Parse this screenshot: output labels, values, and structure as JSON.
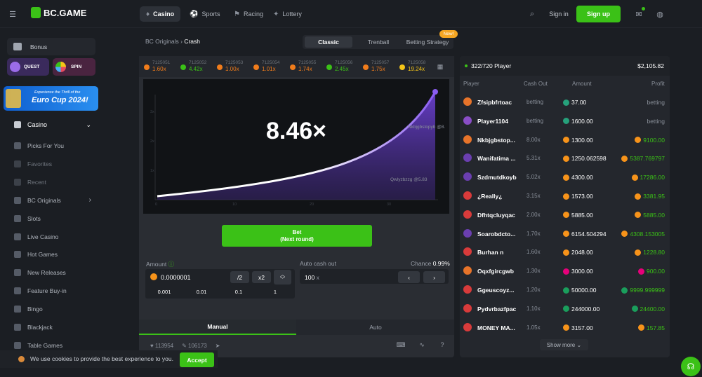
{
  "topbar": {
    "logo": "BC.GAME",
    "tabs": [
      {
        "label": "Casino",
        "icon": "casino-icon",
        "active": true
      },
      {
        "label": "Sports",
        "icon": "sports-icon",
        "active": false
      },
      {
        "label": "Racing",
        "icon": "racing-icon",
        "active": false
      },
      {
        "label": "Lottery",
        "icon": "lottery-icon",
        "active": false
      }
    ],
    "signin": "Sign in",
    "signup": "Sign up"
  },
  "sidebar": {
    "bonus": "Bonus",
    "quest": "QUEST",
    "spin": "SPIN",
    "promo_line1": "Experience the Thrill of the",
    "promo_line2": "Euro Cup 2024!",
    "casino": "Casino",
    "items": [
      {
        "label": "Picks For You",
        "dim": false
      },
      {
        "label": "Favorites",
        "dim": true
      },
      {
        "label": "Recent",
        "dim": true
      },
      {
        "label": "BC Originals",
        "dim": false
      },
      {
        "label": "Slots",
        "dim": false
      },
      {
        "label": "Live Casino",
        "dim": false
      },
      {
        "label": "Hot Games",
        "dim": false
      },
      {
        "label": "New Releases",
        "dim": false
      },
      {
        "label": "Feature Buy-in",
        "dim": false
      },
      {
        "label": "Bingo",
        "dim": false
      },
      {
        "label": "Blackjack",
        "dim": false
      },
      {
        "label": "Table Games",
        "dim": false
      }
    ]
  },
  "breadcrumb": {
    "parent": "BC Originals",
    "current": "Crash"
  },
  "modes": {
    "tabs": [
      "Classic",
      "Trenball",
      "Betting Strategy"
    ],
    "new_badge": "New!"
  },
  "history": [
    {
      "id": "7125051",
      "mul": "1.60x",
      "color": "#f07c1b"
    },
    {
      "id": "7125052",
      "mul": "4.42x",
      "color": "#3bc117"
    },
    {
      "id": "7125053",
      "mul": "1.00x",
      "color": "#f07c1b"
    },
    {
      "id": "7125054",
      "mul": "1.01x",
      "color": "#f07c1b"
    },
    {
      "id": "7125055",
      "mul": "1.74x",
      "color": "#f07c1b"
    },
    {
      "id": "7125056",
      "mul": "2.45x",
      "color": "#3bc117"
    },
    {
      "id": "7125057",
      "mul": "1.75x",
      "color": "#f07c1b"
    },
    {
      "id": "7125058",
      "mul": "19.24x",
      "color": "#f5c518"
    }
  ],
  "chart": {
    "multiplier": "8.46×",
    "players": [
      "Nkbjgbstopyb @8.",
      "Qwlyzbzzg @5.83"
    ],
    "y_ticks": [
      "1x",
      "2x",
      "3x"
    ],
    "x_ticks": [
      "0",
      "10",
      "20",
      "30"
    ]
  },
  "bet": {
    "button_line1": "Bet",
    "button_line2": "(Next round)",
    "amount_label": "Amount",
    "amount_value": "0.0000001",
    "half": "/2",
    "double": "x2",
    "quick": [
      "0.001",
      "0.01",
      "0.1",
      "1"
    ],
    "autocash_label": "Auto cash out",
    "autocash_value": "100",
    "autocash_unit": "x",
    "chance_label": "Chance",
    "chance_value": "0.99%",
    "tab_manual": "Manual",
    "tab_auto": "Auto",
    "likes": "113954",
    "comments": "106173"
  },
  "players": {
    "count": "322/720 Player",
    "total": "$2,105.82",
    "headers": [
      "Player",
      "Cash Out",
      "Amount",
      "Profit"
    ],
    "rows": [
      {
        "name": "Zfsipbfrtoac",
        "cashout": "betting",
        "amount": "37.00",
        "profit": "betting",
        "coin": "#26a17b",
        "avatar": "#e8742a"
      },
      {
        "name": "Player1104",
        "cashout": "betting",
        "amount": "1600.00",
        "profit": "betting",
        "coin": "#26a17b",
        "avatar": "#8a4ec7"
      },
      {
        "name": "Nkbjgbstop...",
        "cashout": "8.00x",
        "amount": "1300.00",
        "profit": "9100.00",
        "coin": "#f7931a",
        "avatar": "#e8742a"
      },
      {
        "name": "Wanifatima ...",
        "cashout": "5.31x",
        "amount": "1250.062598",
        "profit": "5387.769797",
        "coin": "#f7931a",
        "avatar": "#6b3fb0"
      },
      {
        "name": "Szdmutdkoyb",
        "cashout": "5.02x",
        "amount": "4300.00",
        "profit": "17286.00",
        "coin": "#f7931a",
        "avatar": "#6b3fb0"
      },
      {
        "name": "¿Really¿",
        "cashout": "3.15x",
        "amount": "1573.00",
        "profit": "3381.95",
        "coin": "#f7931a",
        "avatar": "#d93b3b"
      },
      {
        "name": "Dfhtqcluyqac",
        "cashout": "2.00x",
        "amount": "5885.00",
        "profit": "5885.00",
        "coin": "#f7931a",
        "avatar": "#d93b3b"
      },
      {
        "name": "Soarobdcto...",
        "cashout": "1.70x",
        "amount": "6154.504294",
        "profit": "4308.153005",
        "coin": "#f7931a",
        "avatar": "#6b3fb0"
      },
      {
        "name": "Burhan n",
        "cashout": "1.60x",
        "amount": "2048.00",
        "profit": "1228.80",
        "coin": "#f7931a",
        "avatar": "#d93b3b"
      },
      {
        "name": "Oqxfgircgwb",
        "cashout": "1.30x",
        "amount": "3000.00",
        "profit": "900.00",
        "coin": "#e6007a",
        "avatar": "#e8742a"
      },
      {
        "name": "Ggeuscoyz...",
        "cashout": "1.20x",
        "amount": "50000.00",
        "profit": "9999.999999",
        "coin": "#1a9e5c",
        "avatar": "#d93b3b"
      },
      {
        "name": "Pydvrbazfpac",
        "cashout": "1.10x",
        "amount": "244000.00",
        "profit": "24400.00",
        "coin": "#1a9e5c",
        "avatar": "#d93b3b"
      },
      {
        "name": "MONEY MA...",
        "cashout": "1.05x",
        "amount": "3157.00",
        "profit": "157.85",
        "coin": "#f7931a",
        "avatar": "#d93b3b"
      }
    ],
    "show_more": "Show more"
  },
  "cookie": {
    "text": "We use cookies to provide the best experience to you.",
    "accept": "Accept"
  },
  "colors": {
    "accent": "#3bc117",
    "panel": "#24272d",
    "bg": "#1b1e23",
    "curve": "#7b4fe0"
  }
}
